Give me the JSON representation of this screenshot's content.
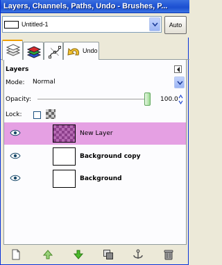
{
  "window": {
    "title": "Layers, Channels, Paths, Undo - Brushes, P..."
  },
  "image_selector": {
    "value": "Untitled-1",
    "auto_label": "Auto"
  },
  "tabs": [
    {
      "name": "layers",
      "label": ""
    },
    {
      "name": "channels",
      "label": ""
    },
    {
      "name": "paths",
      "label": ""
    },
    {
      "name": "undo",
      "label": "Undo"
    }
  ],
  "panel": {
    "title": "Layers",
    "mode_label": "Mode:",
    "mode_value": "Normal",
    "opacity_label": "Opacity:",
    "opacity_value": "100.0",
    "opacity_level": 1.0,
    "lock_label": "Lock:"
  },
  "layers": [
    {
      "name": "New Layer",
      "visible": true,
      "selected": true,
      "transparent": true
    },
    {
      "name": "Background copy",
      "visible": true,
      "selected": false,
      "transparent": false
    },
    {
      "name": "Background",
      "visible": true,
      "selected": false,
      "transparent": false
    }
  ],
  "toolbar": [
    "new-layer-icon",
    "raise-layer-icon",
    "lower-layer-icon",
    "duplicate-layer-icon",
    "anchor-layer-icon",
    "delete-layer-icon"
  ],
  "colors": {
    "titlebar": "#2458d6",
    "selected_layer": "#e5a0e3",
    "panel_bg": "#fcfcfe",
    "chrome_bg": "#ece9d8"
  }
}
